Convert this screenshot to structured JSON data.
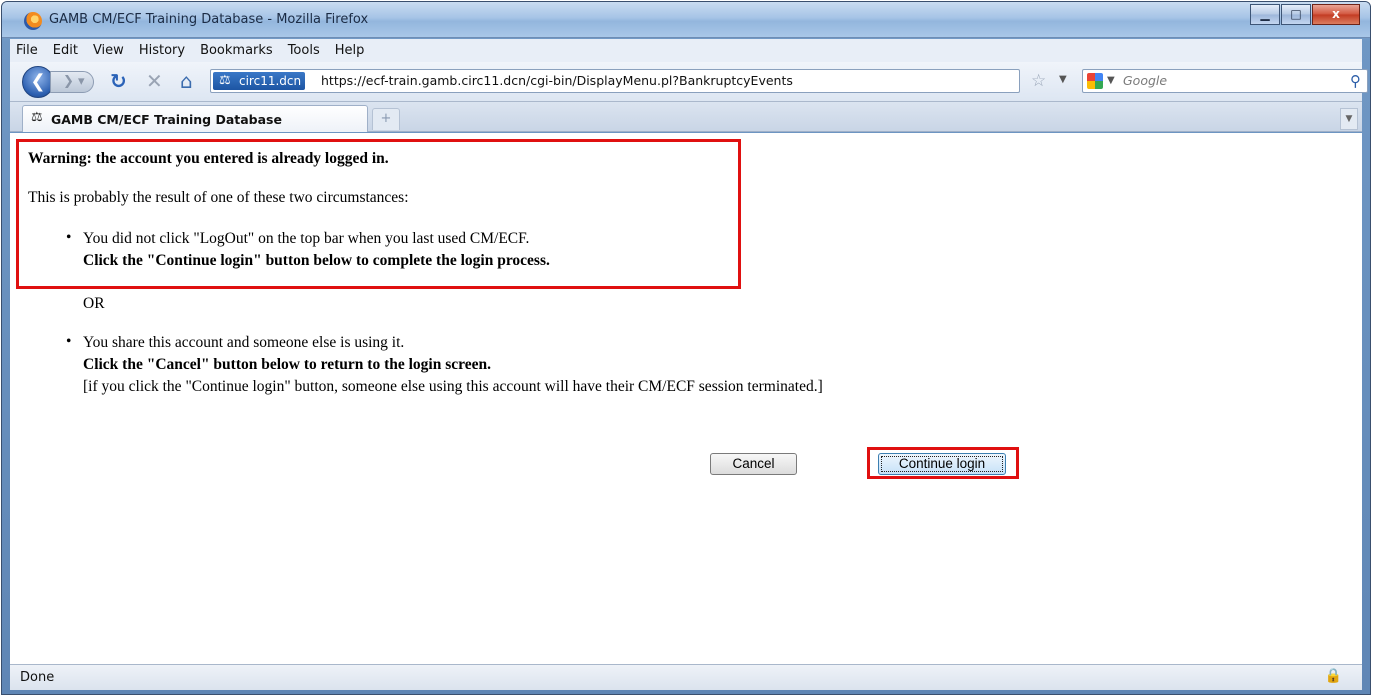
{
  "window": {
    "title": "GAMB CM/ECF Training Database - Mozilla Firefox",
    "controls": {
      "minimize": "▁",
      "maximize": "□",
      "close": "x"
    }
  },
  "menubar": {
    "items": [
      "File",
      "Edit",
      "View",
      "History",
      "Bookmarks",
      "Tools",
      "Help"
    ]
  },
  "navbar": {
    "site_identity": "circ11.dcn",
    "url": "https://ecf-train.gamb.circ11.dcn/cgi-bin/DisplayMenu.pl?BankruptcyEvents",
    "search_placeholder": "Google",
    "icons": [
      "back-icon",
      "forward-icon",
      "reload-icon",
      "stop-icon",
      "home-icon",
      "star-icon",
      "search-icon"
    ]
  },
  "tabs": [
    {
      "label": "GAMB CM/ECF Training Database",
      "active": true
    }
  ],
  "page": {
    "warning": "Warning: the account you entered is already logged in.",
    "intro": "This is probably the result of one of these two circumstances:",
    "bullet1": {
      "line1": "You did not click \"LogOut\" on the top bar when you last used CM/ECF.",
      "line2": "Click the \"Continue login\" button below to complete the login process."
    },
    "or": "OR",
    "bullet2": {
      "line1": "You share this account and someone else is using it.",
      "line2": "Click the \"Cancel\" button below to return to the login screen.",
      "line3": "[if you click the \"Continue login\" button, someone else using this account will have their CM/ECF session terminated.]"
    },
    "buttons": {
      "cancel": "Cancel",
      "continue": "Continue login"
    },
    "highlight_color": "#e01010"
  },
  "statusbar": {
    "text": "Done"
  }
}
